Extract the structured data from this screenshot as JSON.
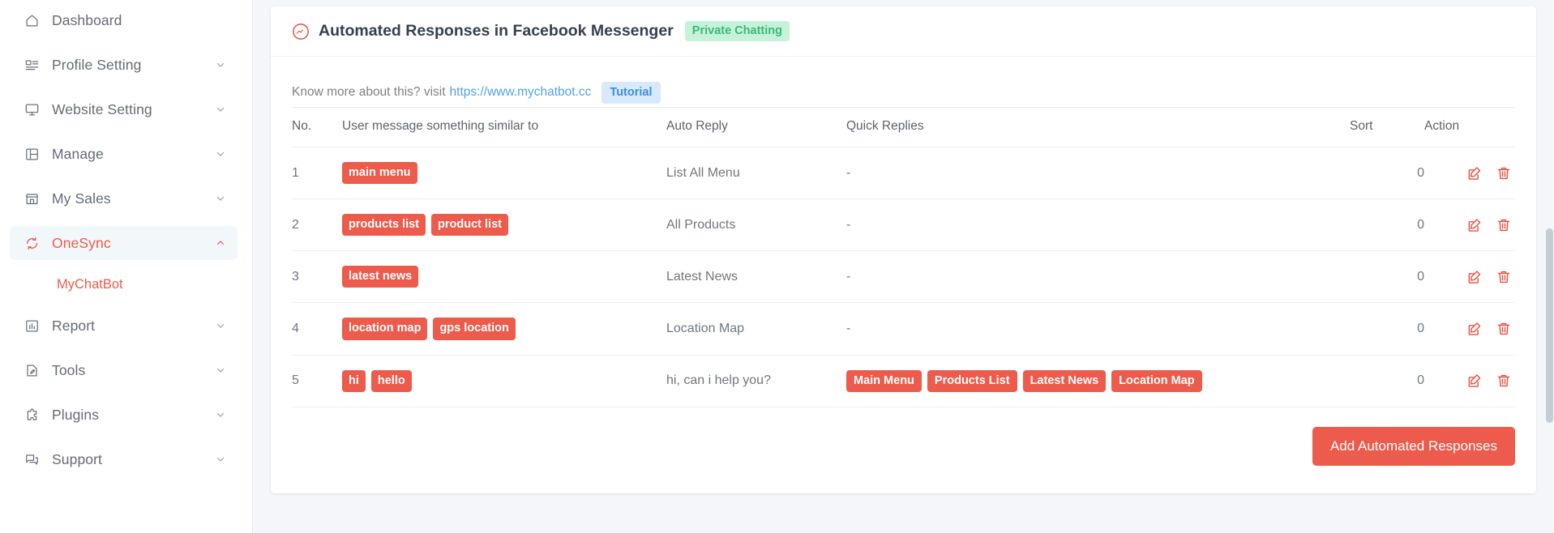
{
  "sidebar": {
    "items": [
      {
        "label": "Dashboard",
        "icon": "home-icon",
        "chevron": false,
        "active": false
      },
      {
        "label": "Profile Setting",
        "icon": "profile-icon",
        "chevron": true,
        "active": false
      },
      {
        "label": "Website Setting",
        "icon": "monitor-icon",
        "chevron": true,
        "active": false
      },
      {
        "label": "Manage",
        "icon": "layout-icon",
        "chevron": true,
        "active": false
      },
      {
        "label": "My Sales",
        "icon": "store-icon",
        "chevron": true,
        "active": false
      },
      {
        "label": "OneSync",
        "icon": "sync-icon",
        "chevron": true,
        "active": true
      },
      {
        "label": "Report",
        "icon": "chart-icon",
        "chevron": true,
        "active": false
      },
      {
        "label": "Tools",
        "icon": "tools-icon",
        "chevron": true,
        "active": false
      },
      {
        "label": "Plugins",
        "icon": "plugin-icon",
        "chevron": true,
        "active": false
      },
      {
        "label": "Support",
        "icon": "chat-icon",
        "chevron": true,
        "active": false
      }
    ],
    "sub_item": {
      "label": "MyChatBot",
      "parent": "OneSync"
    }
  },
  "card": {
    "title": "Automated Responses in Facebook Messenger",
    "title_icon": "messenger-icon",
    "status_badge": "Private Chatting",
    "info_text": "Know more about this? visit",
    "info_link": "https://www.mychatbot.cc",
    "info_badge": "Tutorial"
  },
  "table": {
    "headers": [
      "No.",
      "User message something similar to",
      "Auto Reply",
      "Quick Replies",
      "Sort",
      "Action"
    ],
    "rows": [
      {
        "no": "1",
        "keywords": [
          "main menu"
        ],
        "auto_reply": "List All Menu",
        "quick_replies": [],
        "quick_replies_empty": "-",
        "sort": "0",
        "edit_icon": "edit-icon",
        "delete_icon": "trash-icon"
      },
      {
        "no": "2",
        "keywords": [
          "products list",
          "product list"
        ],
        "auto_reply": "All Products",
        "quick_replies": [],
        "quick_replies_empty": "-",
        "sort": "0",
        "edit_icon": "edit-icon",
        "delete_icon": "trash-icon"
      },
      {
        "no": "3",
        "keywords": [
          "latest news"
        ],
        "auto_reply": "Latest News",
        "quick_replies": [],
        "quick_replies_empty": "-",
        "sort": "0",
        "edit_icon": "edit-icon",
        "delete_icon": "trash-icon"
      },
      {
        "no": "4",
        "keywords": [
          "location map",
          "gps location"
        ],
        "auto_reply": "Location Map",
        "quick_replies": [],
        "quick_replies_empty": "-",
        "sort": "0",
        "edit_icon": "edit-icon",
        "delete_icon": "trash-icon"
      },
      {
        "no": "5",
        "keywords": [
          "hi",
          "hello"
        ],
        "auto_reply": "hi, can i help you?",
        "quick_replies": [
          "Main Menu",
          "Products List",
          "Latest News",
          "Location Map"
        ],
        "quick_replies_empty": "",
        "sort": "0",
        "edit_icon": "edit-icon",
        "delete_icon": "trash-icon"
      }
    ]
  },
  "footer": {
    "add_button": "Add Automated Responses"
  },
  "colors": {
    "accent": "#ec5b4b",
    "badge_green_bg": "#c7f2da",
    "badge_green_text": "#39ba73",
    "badge_blue_bg": "#d8e9fb",
    "badge_blue_text": "#3a8ede",
    "link": "#55a0e8",
    "sidebar_active_bg": "#f2f8fa",
    "page_bg": "#f4f6f9"
  }
}
